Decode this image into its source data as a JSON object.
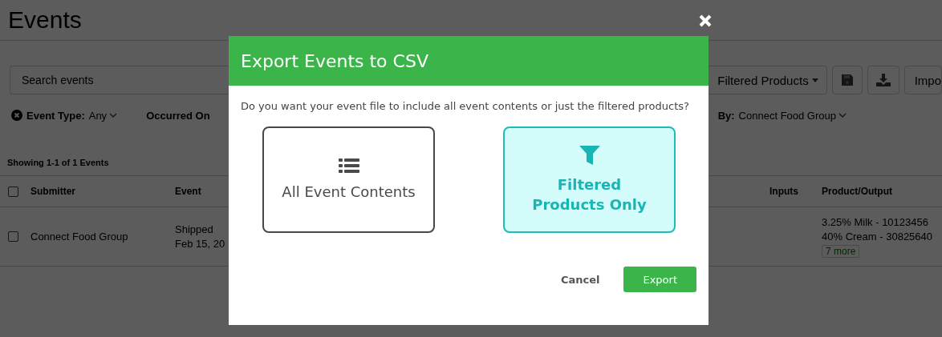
{
  "page": {
    "title": "Events",
    "search": {
      "placeholder": "Search events"
    },
    "toolbar": {
      "export_dropdown": "Filtered Products",
      "import_button": "Impo"
    },
    "filters": [
      {
        "label": "Event Type:",
        "value": "Any",
        "removable": true
      },
      {
        "label": "Occurred On",
        "removable": false
      },
      {
        "label": "By:",
        "value": "Connect Food Group",
        "removable": false
      }
    ],
    "results_summary": "Showing 1-1 of 1 Events",
    "table": {
      "select_all_checked": false,
      "columns": [
        "Submitter",
        "Event",
        "Inputs",
        "Product/Output"
      ],
      "rows": [
        {
          "checked": false,
          "submitter": "Connect Food Group",
          "event": [
            "Shipped",
            "Feb 15, 20"
          ],
          "products": [
            "3.25% Milk - 10123456",
            "40% Cream - 30825640"
          ],
          "more": "7 more"
        }
      ]
    }
  },
  "dialog": {
    "title": "Export Events to CSV",
    "message": "Do you want your event file to include all event contents or just the filtered products?",
    "options": [
      {
        "kind": "all",
        "label": "All Event Contents",
        "selected": false
      },
      {
        "kind": "filtered",
        "label": "Filtered Products Only",
        "selected": true
      }
    ],
    "buttons": [
      {
        "kind": "text",
        "label": "Cancel"
      },
      {
        "kind": "primary",
        "label": "Export"
      }
    ]
  }
}
